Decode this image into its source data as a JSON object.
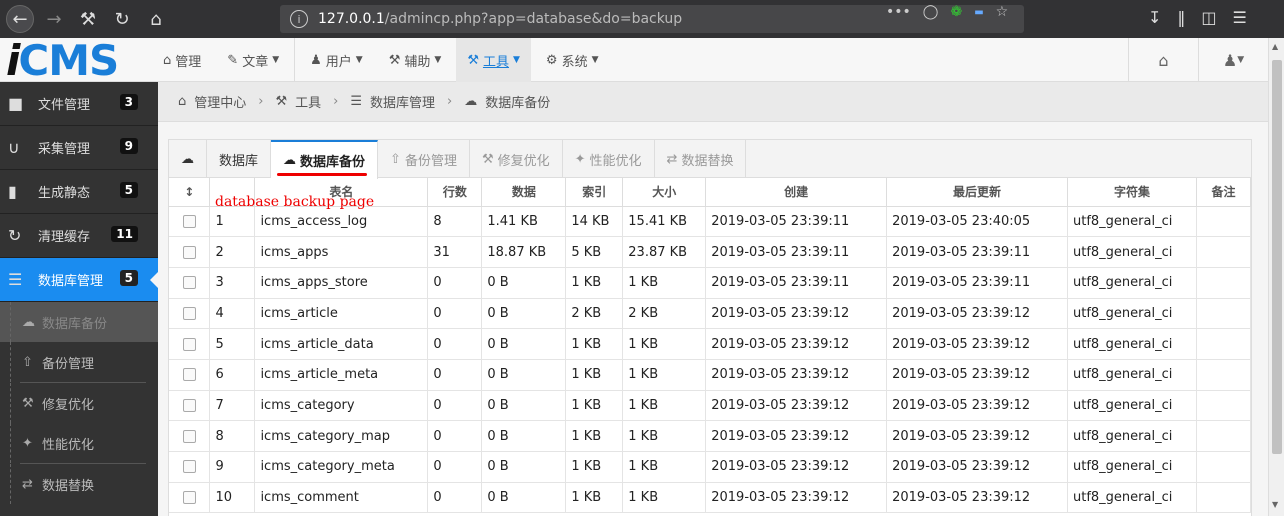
{
  "browser": {
    "url_host": "127.0.0.1",
    "url_path": "/admincp.php?app=database&do=backup"
  },
  "header": {
    "logo_i": "i",
    "logo_cms": "CMS",
    "nav": [
      {
        "label": "管理",
        "icon": "home-icon"
      },
      {
        "label": "文章",
        "icon": "edit-icon",
        "dropdown": true
      },
      {
        "label": "用户",
        "icon": "user-icon",
        "dropdown": true
      },
      {
        "label": "辅助",
        "icon": "gavel-icon",
        "dropdown": true
      },
      {
        "label": "工具",
        "icon": "gavel-icon",
        "dropdown": true,
        "active": true
      },
      {
        "label": "系统",
        "icon": "gear-icon",
        "dropdown": true
      }
    ]
  },
  "sidebar": {
    "items": [
      {
        "label": "文件管理",
        "badge": "3",
        "icon": "folder-icon"
      },
      {
        "label": "采集管理",
        "badge": "9",
        "icon": "magnet-icon"
      },
      {
        "label": "生成静态",
        "badge": "5",
        "icon": "file-icon"
      },
      {
        "label": "清理缓存",
        "badge": "11",
        "icon": "refresh-icon"
      },
      {
        "label": "数据库管理",
        "badge": "5",
        "icon": "database-icon",
        "active": true
      }
    ],
    "subitems": [
      {
        "label": "数据库备份",
        "active": true
      },
      {
        "label": "备份管理"
      },
      {
        "label": "修复优化"
      },
      {
        "label": "性能优化"
      },
      {
        "label": "数据替换"
      }
    ]
  },
  "breadcrumb": [
    "管理中心",
    "工具",
    "数据库管理",
    "数据库备份"
  ],
  "tabs": [
    {
      "label": "数据库"
    },
    {
      "label": "数据库备份",
      "active": true
    },
    {
      "label": "备份管理"
    },
    {
      "label": "修复优化"
    },
    {
      "label": "性能优化"
    },
    {
      "label": "数据替换"
    }
  ],
  "table": {
    "columns": [
      "表名",
      "行数",
      "数据",
      "索引",
      "大小",
      "创建",
      "最后更新",
      "字符集",
      "备注"
    ],
    "rows": [
      [
        "1",
        "icms_access_log",
        "8",
        "1.41 KB",
        "14 KB",
        "15.41 KB",
        "2019-03-05 23:39:11",
        "2019-03-05 23:40:05",
        "utf8_general_ci"
      ],
      [
        "2",
        "icms_apps",
        "31",
        "18.87 KB",
        "5 KB",
        "23.87 KB",
        "2019-03-05 23:39:11",
        "2019-03-05 23:39:11",
        "utf8_general_ci"
      ],
      [
        "3",
        "icms_apps_store",
        "0",
        "0 B",
        "1 KB",
        "1 KB",
        "2019-03-05 23:39:11",
        "2019-03-05 23:39:11",
        "utf8_general_ci"
      ],
      [
        "4",
        "icms_article",
        "0",
        "0 B",
        "2 KB",
        "2 KB",
        "2019-03-05 23:39:12",
        "2019-03-05 23:39:12",
        "utf8_general_ci"
      ],
      [
        "5",
        "icms_article_data",
        "0",
        "0 B",
        "1 KB",
        "1 KB",
        "2019-03-05 23:39:12",
        "2019-03-05 23:39:12",
        "utf8_general_ci"
      ],
      [
        "6",
        "icms_article_meta",
        "0",
        "0 B",
        "1 KB",
        "1 KB",
        "2019-03-05 23:39:12",
        "2019-03-05 23:39:12",
        "utf8_general_ci"
      ],
      [
        "7",
        "icms_category",
        "0",
        "0 B",
        "1 KB",
        "1 KB",
        "2019-03-05 23:39:12",
        "2019-03-05 23:39:12",
        "utf8_general_ci"
      ],
      [
        "8",
        "icms_category_map",
        "0",
        "0 B",
        "1 KB",
        "1 KB",
        "2019-03-05 23:39:12",
        "2019-03-05 23:39:12",
        "utf8_general_ci"
      ],
      [
        "9",
        "icms_category_meta",
        "0",
        "0 B",
        "1 KB",
        "1 KB",
        "2019-03-05 23:39:12",
        "2019-03-05 23:39:12",
        "utf8_general_ci"
      ],
      [
        "10",
        "icms_comment",
        "0",
        "0 B",
        "1 KB",
        "1 KB",
        "2019-03-05 23:39:12",
        "2019-03-05 23:39:12",
        "utf8_general_ci"
      ]
    ]
  },
  "annotation": "database backup page"
}
